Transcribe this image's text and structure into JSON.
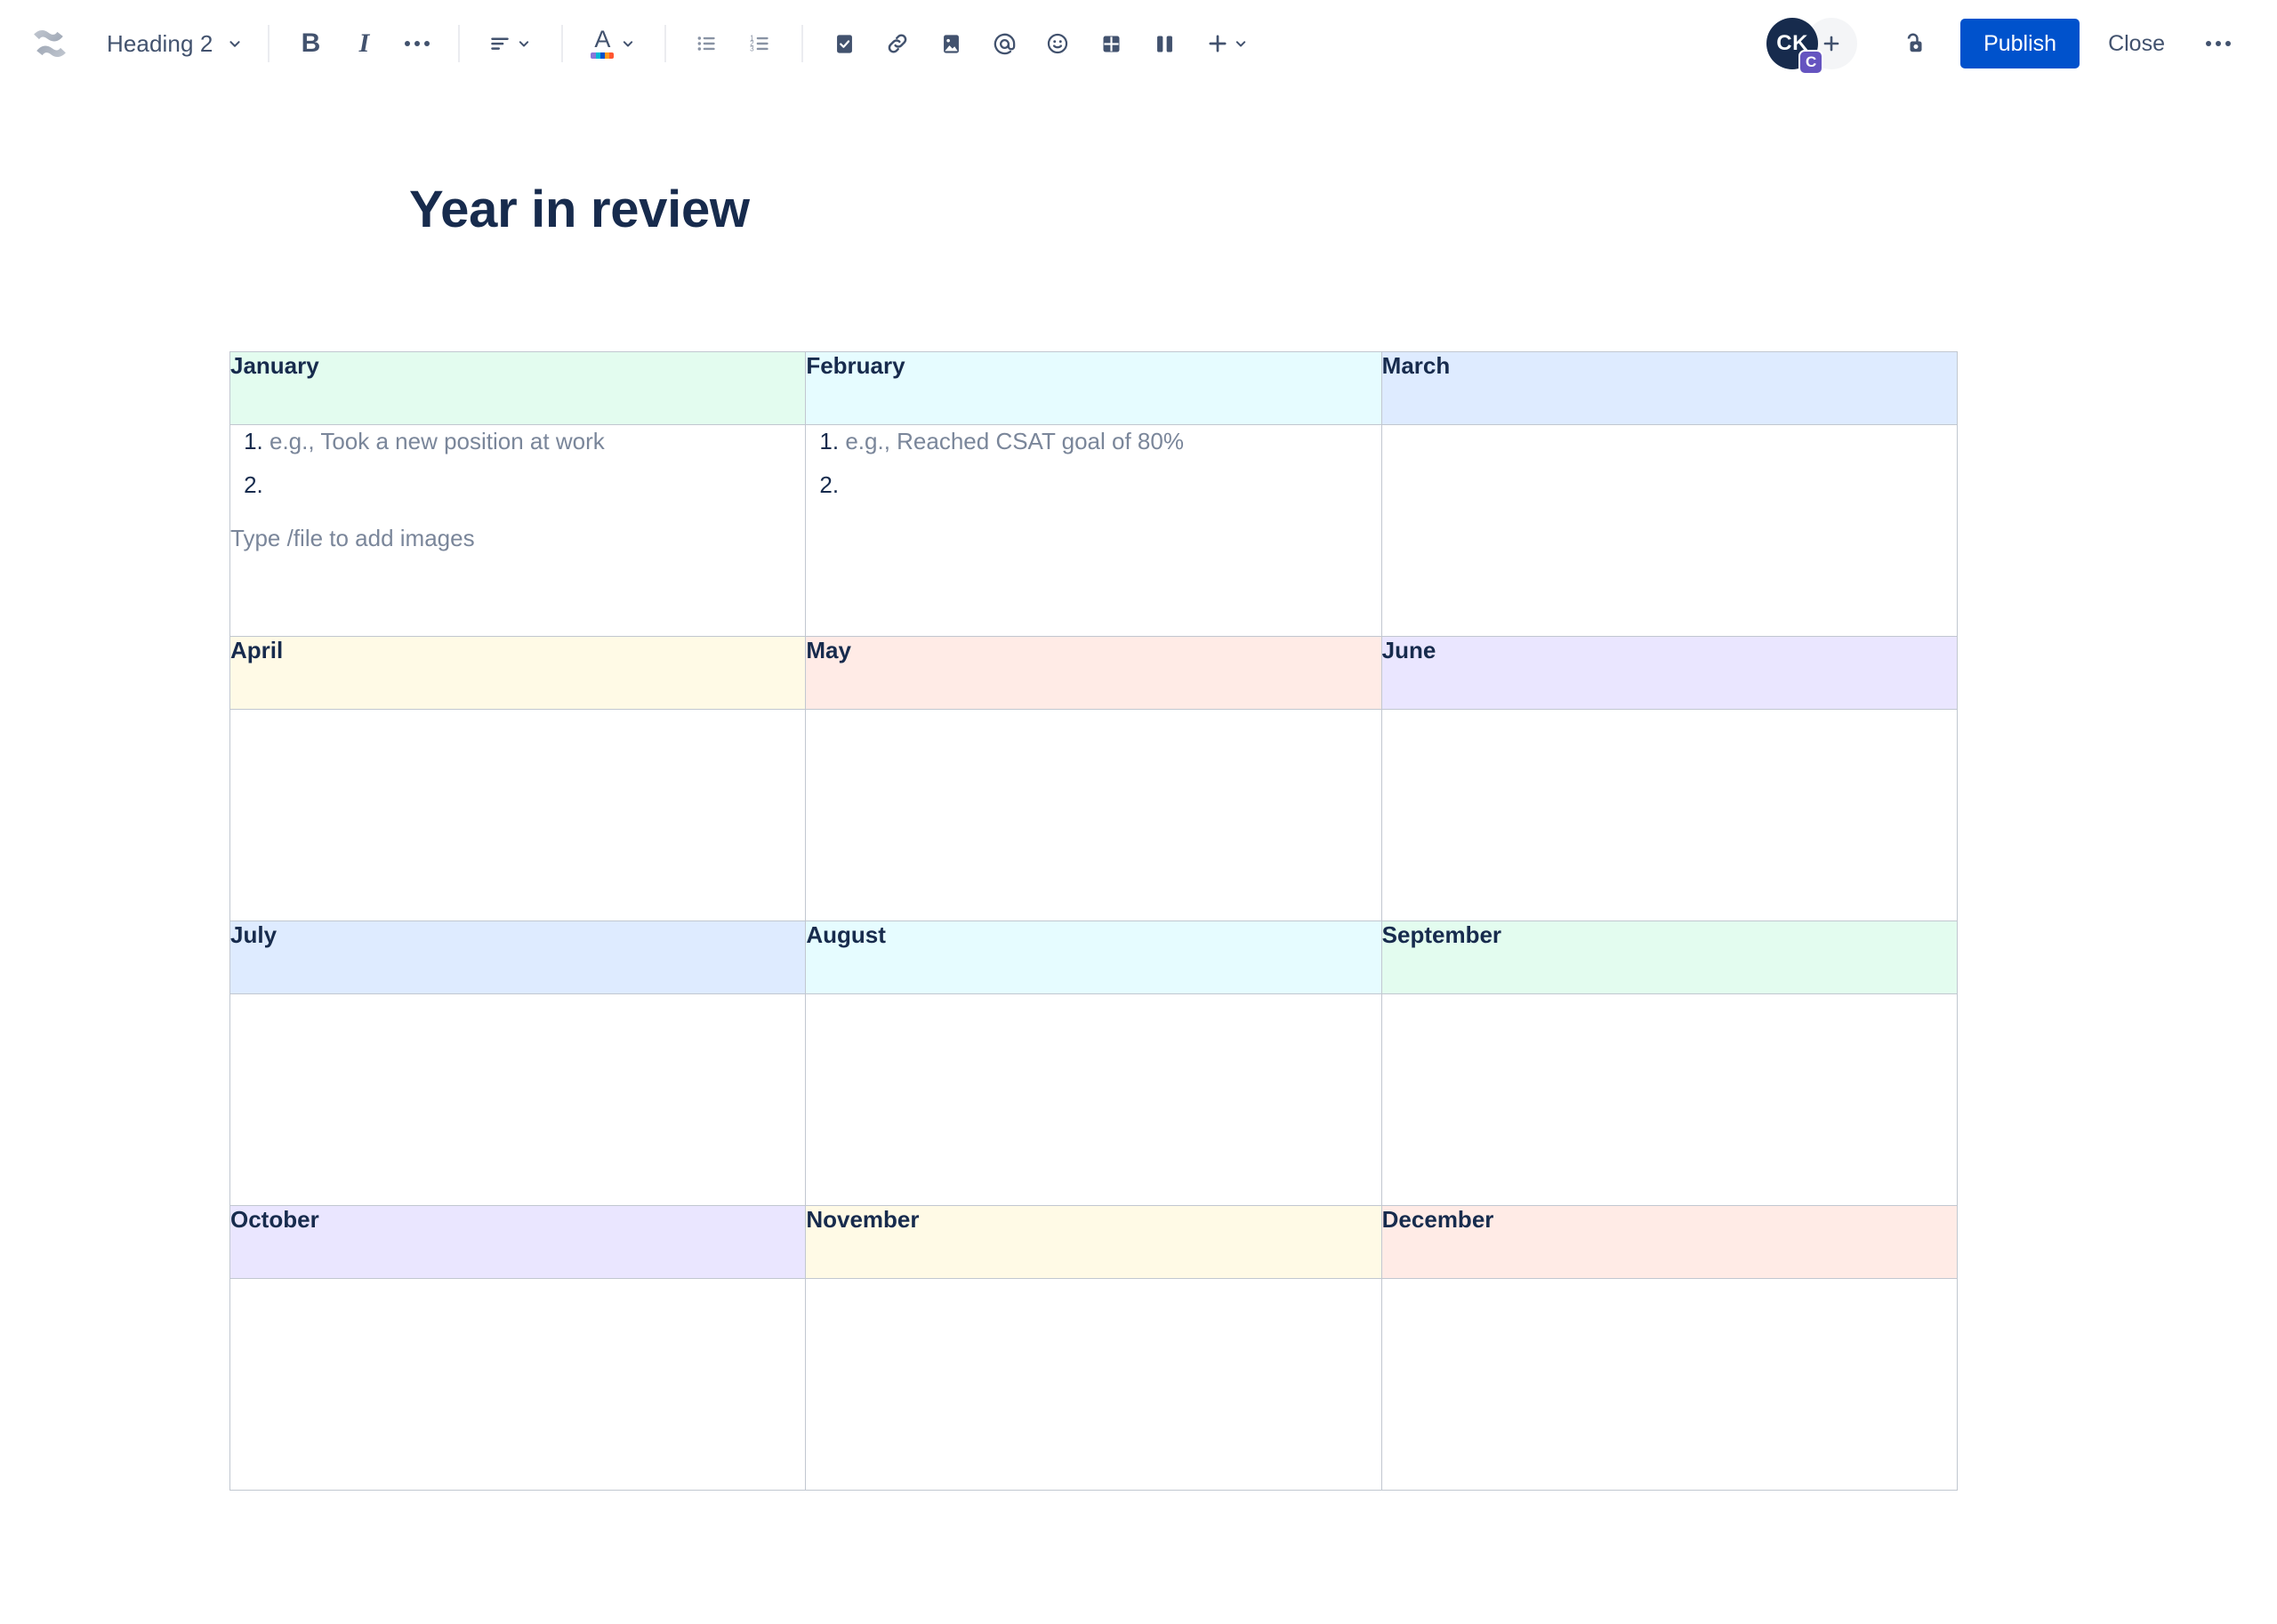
{
  "app": {
    "logo_icon": "confluence-logo-icon"
  },
  "toolbar": {
    "style_select": {
      "value": "Heading 2",
      "caret_icon": "chevron-down-icon"
    },
    "buttons": [
      {
        "name": "bold",
        "label": "B",
        "icon": "bold-icon"
      },
      {
        "name": "italic",
        "label": "I",
        "icon": "italic-icon"
      },
      {
        "name": "more-formatting",
        "label": "",
        "icon": "ellipsis-icon"
      },
      {
        "name": "text-align",
        "label": "",
        "icon": "text-align-left-icon"
      },
      {
        "name": "text-color",
        "label": "A",
        "icon": "text-color-icon"
      },
      {
        "name": "bulleted-list",
        "label": "",
        "icon": "bulleted-list-icon"
      },
      {
        "name": "numbered-list",
        "label": "",
        "icon": "numbered-list-icon"
      },
      {
        "name": "task-list",
        "label": "",
        "icon": "checkbox-icon"
      },
      {
        "name": "link",
        "label": "",
        "icon": "link-icon"
      },
      {
        "name": "image",
        "label": "",
        "icon": "image-icon"
      },
      {
        "name": "mention",
        "label": "",
        "icon": "mention-at-icon"
      },
      {
        "name": "emoji",
        "label": "",
        "icon": "emoji-smiley-icon"
      },
      {
        "name": "table",
        "label": "",
        "icon": "table-icon"
      },
      {
        "name": "layout",
        "label": "",
        "icon": "columns-layout-icon"
      },
      {
        "name": "insert-more",
        "label": "",
        "icon": "plus-icon"
      }
    ],
    "user": {
      "initials": "CK",
      "badge": "C",
      "add_icon": "person-add-plus-icon"
    },
    "restrictions_icon": "unlocked-padlock-icon",
    "publish_label": "Publish",
    "close_label": "Close",
    "more_actions_icon": "ellipsis-icon"
  },
  "colors": {
    "brand_blue": "#0052cc",
    "text_dark": "#172b4d",
    "text_subtle": "#7a869a",
    "border": "#c1c7d0",
    "green": "#e3fcef",
    "cyan": "#e6fcff",
    "blue": "#deebff",
    "yellow": "#fffae6",
    "red": "#ffebe6",
    "purple": "#eae6ff",
    "badge_purple": "#6554c0"
  },
  "document": {
    "title": "Year in review",
    "table": {
      "rows": [
        {
          "headers": [
            {
              "label": "January",
              "color": "#e3fcef"
            },
            {
              "label": "February",
              "color": "#e6fcff"
            },
            {
              "label": "March",
              "color": "#deebff"
            }
          ],
          "cells": [
            {
              "list": [
                {
                  "text": "e.g., Took a new position at work",
                  "placeholder": true
                },
                {
                  "text": "",
                  "placeholder": false
                }
              ],
              "file_hint": "Type /file to add images"
            },
            {
              "list": [
                {
                  "text": "e.g., Reached CSAT goal of 80%",
                  "placeholder": true
                },
                {
                  "text": "",
                  "placeholder": false
                }
              ],
              "file_hint": ""
            },
            {
              "list": [],
              "file_hint": ""
            }
          ]
        },
        {
          "headers": [
            {
              "label": "April",
              "color": "#fffae6"
            },
            {
              "label": "May",
              "color": "#ffebe6"
            },
            {
              "label": "June",
              "color": "#eae6ff"
            }
          ],
          "cells": [
            {
              "list": [],
              "file_hint": ""
            },
            {
              "list": [],
              "file_hint": ""
            },
            {
              "list": [],
              "file_hint": ""
            }
          ]
        },
        {
          "headers": [
            {
              "label": "July",
              "color": "#deebff"
            },
            {
              "label": "August",
              "color": "#e6fcff"
            },
            {
              "label": "September",
              "color": "#e3fcef"
            }
          ],
          "cells": [
            {
              "list": [],
              "file_hint": ""
            },
            {
              "list": [],
              "file_hint": ""
            },
            {
              "list": [],
              "file_hint": ""
            }
          ]
        },
        {
          "headers": [
            {
              "label": "October",
              "color": "#eae6ff"
            },
            {
              "label": "November",
              "color": "#fffae6"
            },
            {
              "label": "December",
              "color": "#ffebe6"
            }
          ],
          "cells": [
            {
              "list": [],
              "file_hint": ""
            },
            {
              "list": [],
              "file_hint": ""
            },
            {
              "list": [],
              "file_hint": ""
            }
          ]
        }
      ]
    }
  }
}
